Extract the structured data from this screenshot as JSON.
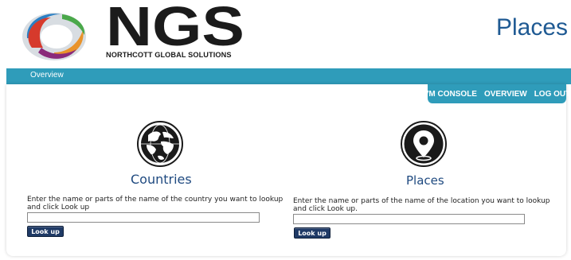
{
  "header": {
    "logo_text": "NGS",
    "logo_subtitle": "NORTHCOTT GLOBAL SOLUTIONS",
    "page_title": "Places"
  },
  "nav": {
    "breadcrumb": "Overview",
    "links": [
      "VM CONSOLE",
      "OVERVIEW",
      "LOG OUT"
    ]
  },
  "countries": {
    "title": "Countries",
    "instruction": "Enter the name or parts of the name of the country you want to lookup and click Look up",
    "input_value": "",
    "button_label": "Look up"
  },
  "places": {
    "title": "Places",
    "instruction": "Enter the name or parts of the name of the location you want to lookup and click Look up.",
    "input_value": "",
    "button_label": "Look up"
  },
  "colors": {
    "nav_bar": "#2f9cba",
    "title_blue": "#1f4a80",
    "button_navy": "#1f3a66"
  },
  "icons": {
    "logo": "ngs-swirl-logo",
    "countries": "globe-icon",
    "places": "map-pin-icon"
  }
}
